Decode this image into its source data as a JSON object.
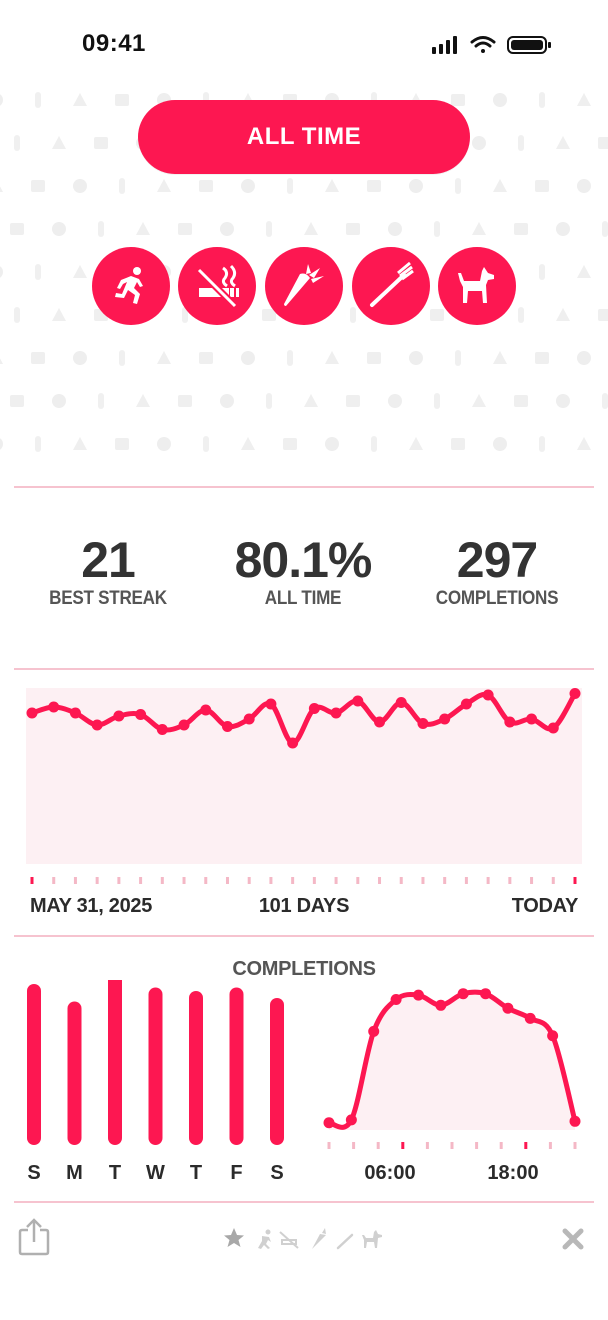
{
  "status": {
    "time": "09:41"
  },
  "filter": {
    "label": "ALL TIME"
  },
  "habits": [
    {
      "name": "running",
      "icon": "runner-icon"
    },
    {
      "name": "no smoking",
      "icon": "no-smoking-icon"
    },
    {
      "name": "carrot",
      "icon": "carrot-icon"
    },
    {
      "name": "toothbrush",
      "icon": "toothbrush-icon"
    },
    {
      "name": "dog",
      "icon": "dog-icon"
    }
  ],
  "stats": [
    {
      "value": "21",
      "label": "BEST STREAK"
    },
    {
      "value": "80.1%",
      "label": "ALL TIME"
    },
    {
      "value": "297",
      "label": "COMPLETIONS"
    }
  ],
  "trend": {
    "start_label": "MAY 31, 2025",
    "mid_label": "101 DAYS",
    "end_label": "TODAY"
  },
  "completions_title": "COMPLETIONS",
  "colors": {
    "accent": "#fd1751",
    "fill": "#fdf0f3",
    "divider": "#f6c3cf"
  },
  "chart_data": [
    {
      "type": "area",
      "title": "",
      "x_range": [
        "MAY 31, 2025",
        "TODAY"
      ],
      "y_range": [
        0,
        1
      ],
      "values": [
        0.78,
        0.82,
        0.78,
        0.7,
        0.76,
        0.77,
        0.67,
        0.7,
        0.8,
        0.69,
        0.74,
        0.84,
        0.58,
        0.81,
        0.78,
        0.86,
        0.72,
        0.85,
        0.71,
        0.74,
        0.84,
        0.9,
        0.72,
        0.74,
        0.68,
        0.91
      ]
    },
    {
      "type": "bar",
      "title": "COMPLETIONS",
      "categories": [
        "S",
        "M",
        "T",
        "W",
        "T",
        "F",
        "S"
      ],
      "values": [
        46,
        41,
        50,
        45,
        44,
        45,
        42
      ]
    },
    {
      "type": "area",
      "title": "COMPLETIONS",
      "x_ticks": [
        "06:00",
        "18:00"
      ],
      "values": [
        5,
        7,
        68,
        90,
        93,
        86,
        94,
        94,
        84,
        77,
        65,
        6
      ]
    }
  ]
}
